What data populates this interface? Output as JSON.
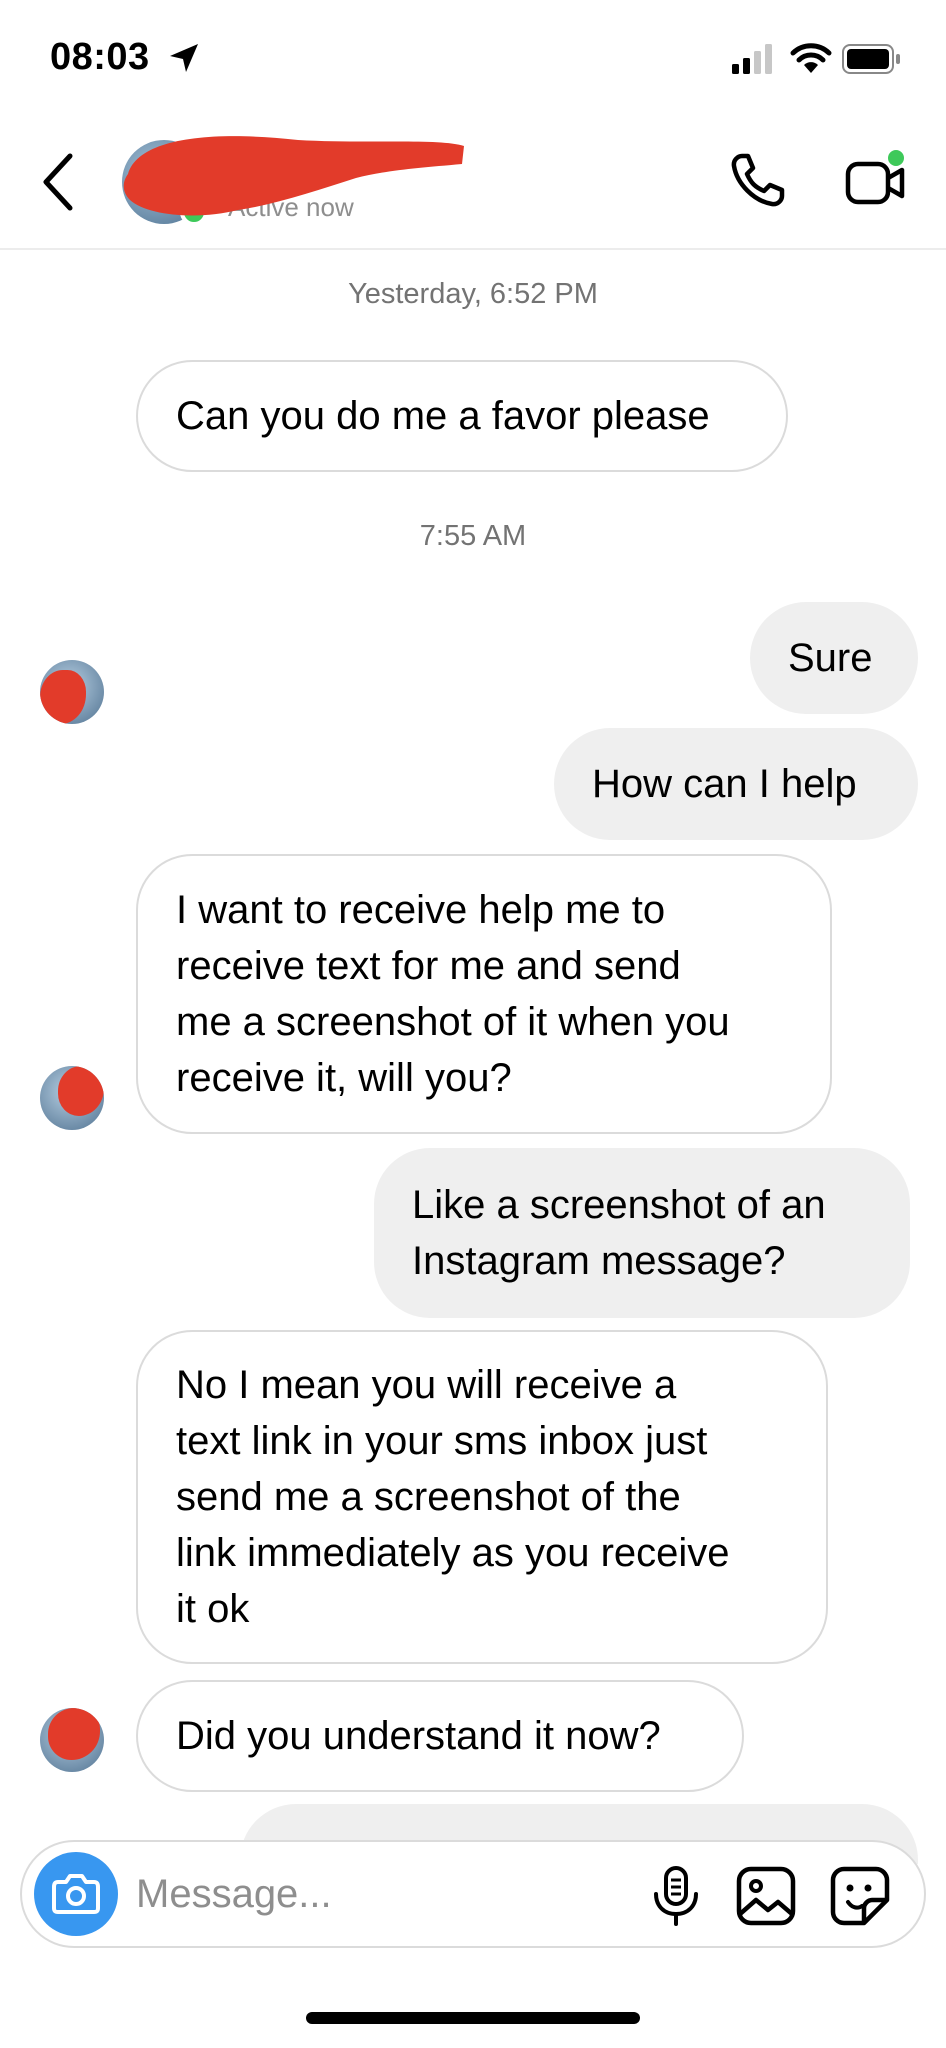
{
  "status_bar": {
    "time": "08:03"
  },
  "header": {
    "contact_status": "Active now"
  },
  "chat": {
    "timestamps": [
      "Yesterday, 6:52 PM",
      "7:55 AM"
    ],
    "messages": [
      {
        "from": "them",
        "text": "Can you do me a favor please"
      },
      {
        "from": "me",
        "text": "Sure"
      },
      {
        "from": "me",
        "text": "How can I help"
      },
      {
        "from": "them",
        "text": "I want to receive help me to\nreceive text for me and send\nme a screenshot of it when you\nreceive it, will you?"
      },
      {
        "from": "me",
        "text": "Like a screenshot of an\nInstagram message?"
      },
      {
        "from": "them",
        "text": "No I mean you will receive a\ntext link in your sms inbox just\nsend me a screenshot of the\nlink immediately as you receive\nit ok"
      },
      {
        "from": "them",
        "text": "Did you understand it now?"
      }
    ]
  },
  "composer": {
    "placeholder": "Message...",
    "icons": [
      "camera-icon",
      "microphone-icon",
      "gallery-icon",
      "sticker-icon"
    ]
  },
  "colors": {
    "accent": "#3897f0",
    "active": "#3ec95a",
    "outgoing_bubble": "#efefef",
    "incoming_border": "#dbdbdb"
  }
}
